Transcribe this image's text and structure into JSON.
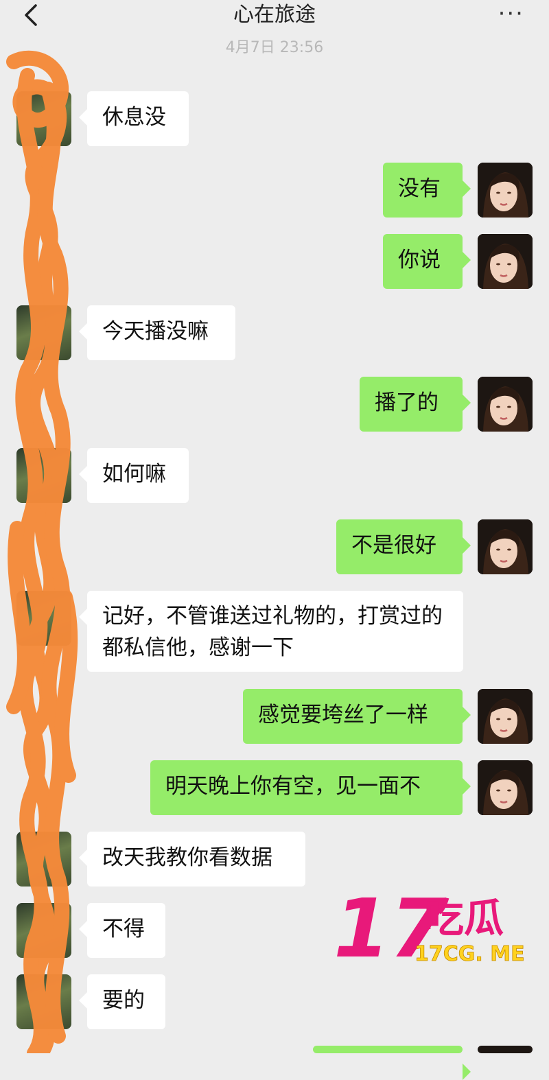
{
  "header": {
    "back_icon": "chevron-left-icon",
    "title": "心在旅途",
    "more_label": "···",
    "timestamp": "4月7日 23:56"
  },
  "messages": [
    {
      "sender": "them",
      "text": "休息没"
    },
    {
      "sender": "me",
      "text": "没有"
    },
    {
      "sender": "me",
      "text": "你说"
    },
    {
      "sender": "them",
      "text": "今天播没嘛"
    },
    {
      "sender": "me",
      "text": "播了的"
    },
    {
      "sender": "them",
      "text": "如何嘛"
    },
    {
      "sender": "me",
      "text": "不是很好"
    },
    {
      "sender": "them",
      "text": "记好，不管谁送过礼物的，打赏过的都私信他，感谢一下"
    },
    {
      "sender": "me",
      "text": "感觉要垮丝了一样"
    },
    {
      "sender": "me",
      "text": "明天晚上你有空，见一面不"
    },
    {
      "sender": "them",
      "text": "改天我教你看数据"
    },
    {
      "sender": "them",
      "text": "不得"
    },
    {
      "sender": "them",
      "text": "要的"
    }
  ],
  "watermark": {
    "big": "17",
    "chinese": "吃瓜",
    "domain": "17CG. ME",
    "colors": {
      "magenta": "#e8197a",
      "yellow": "#ffd21f"
    }
  },
  "colors": {
    "background": "#ededed",
    "bubble_in": "#ffffff",
    "bubble_out": "#95ec69",
    "scribble": "#f58a3a"
  }
}
